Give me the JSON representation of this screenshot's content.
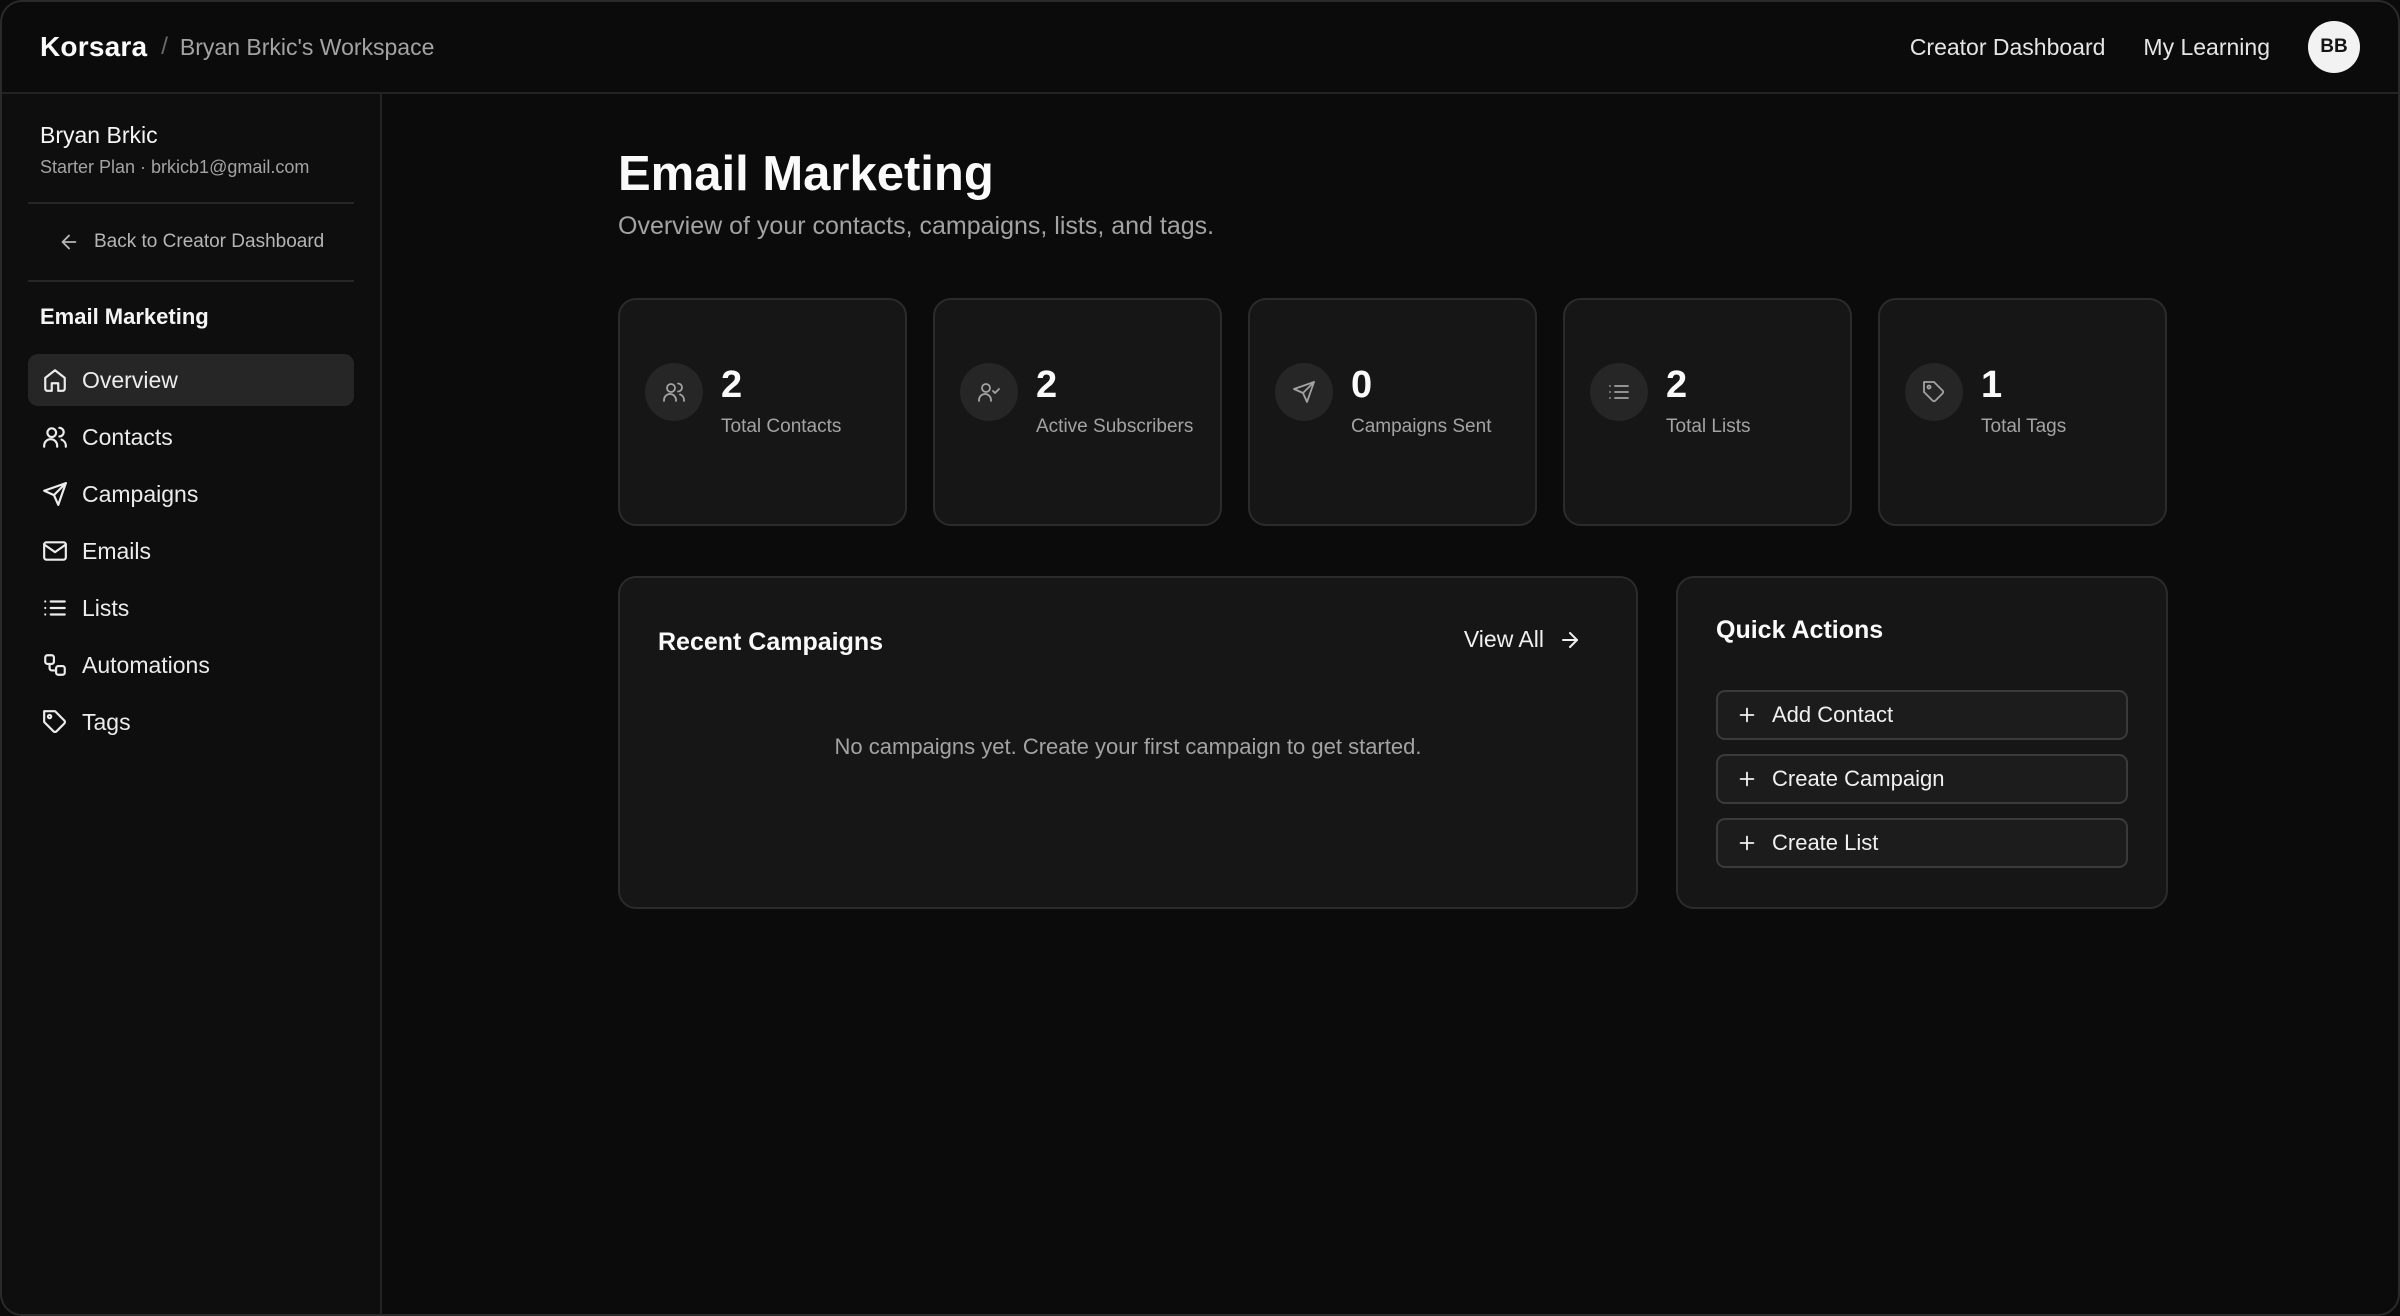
{
  "header": {
    "brand": "Korsara",
    "separator": "/",
    "workspace": "Bryan Brkic's Workspace",
    "nav": [
      {
        "label": "Creator Dashboard"
      },
      {
        "label": "My Learning"
      }
    ],
    "avatar_initials": "BB"
  },
  "sidebar": {
    "user_name": "Bryan Brkic",
    "user_sub": "Starter Plan · brkicb1@gmail.com",
    "back_label": "Back to Creator Dashboard",
    "section_title": "Email Marketing",
    "items": [
      {
        "label": "Overview",
        "icon": "home-icon",
        "active": true
      },
      {
        "label": "Contacts",
        "icon": "users-icon"
      },
      {
        "label": "Campaigns",
        "icon": "send-icon"
      },
      {
        "label": "Emails",
        "icon": "mail-icon"
      },
      {
        "label": "Lists",
        "icon": "list-icon"
      },
      {
        "label": "Automations",
        "icon": "workflow-icon"
      },
      {
        "label": "Tags",
        "icon": "tag-icon"
      }
    ]
  },
  "main": {
    "title": "Email Marketing",
    "subtitle": "Overview of your contacts, campaigns, lists, and tags.",
    "stats": [
      {
        "value": "2",
        "label": "Total Contacts",
        "icon": "users-icon"
      },
      {
        "value": "2",
        "label": "Active Subscribers",
        "icon": "user-check-icon"
      },
      {
        "value": "0",
        "label": "Campaigns Sent",
        "icon": "send-icon"
      },
      {
        "value": "2",
        "label": "Total Lists",
        "icon": "list-icon"
      },
      {
        "value": "1",
        "label": "Total Tags",
        "icon": "tag-icon"
      }
    ],
    "recent": {
      "title": "Recent Campaigns",
      "view_all": "View All",
      "empty": "No campaigns yet. Create your first campaign to get started."
    },
    "quick": {
      "title": "Quick Actions",
      "actions": [
        {
          "label": "Add Contact"
        },
        {
          "label": "Create Campaign"
        },
        {
          "label": "Create List"
        }
      ]
    }
  },
  "colors": {
    "background": "#0b0b0b",
    "card": "#161616",
    "border": "#2b2b2b",
    "muted_text": "#a3a3a3",
    "active_nav": "#262626"
  }
}
